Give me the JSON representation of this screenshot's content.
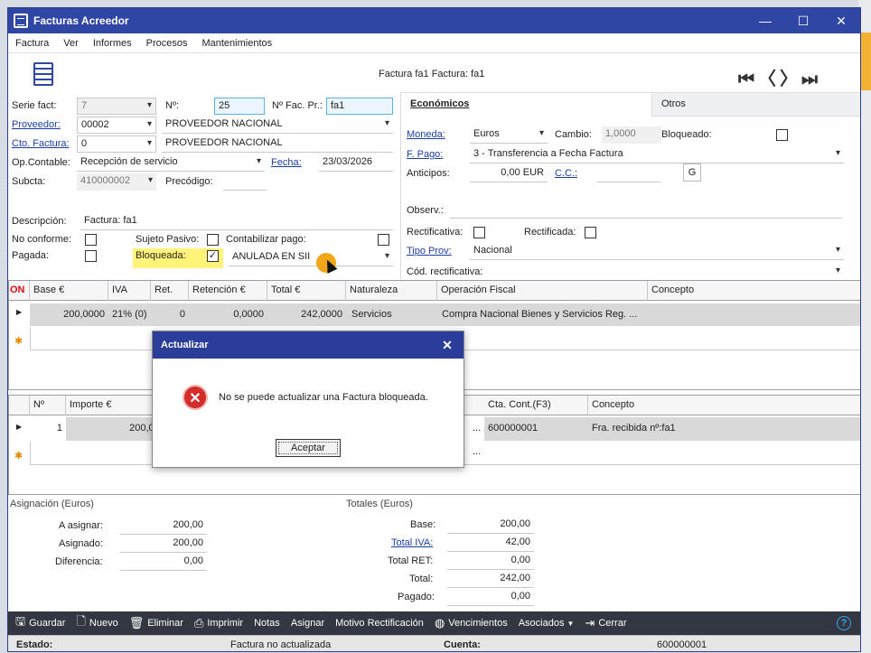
{
  "window": {
    "title": "Facturas Acreedor"
  },
  "menu": [
    "Factura",
    "Ver",
    "Informes",
    "Procesos",
    "Mantenimientos"
  ],
  "header": {
    "title": "Factura fa1  Factura: fa1"
  },
  "nav": {
    "first": "⏮",
    "prev": "〈",
    "next": "〉",
    "last": "⏭"
  },
  "form": {
    "serie_label": "Serie fact:",
    "serie_value": "7",
    "num_label": "Nº:",
    "num_value": "25",
    "nfacpr_label": "Nº Fac. Pr.:",
    "nfacpr_value": "fa1",
    "proveedor_label": "Proveedor:",
    "proveedor_code": "00002",
    "proveedor_name": "PROVEEDOR NACIONAL",
    "cto_label": "Cto. Factura:",
    "cto_value": "0",
    "cto_name": "PROVEEDOR NACIONAL",
    "opcont_label": "Op.Contable:",
    "opcont_value": "Recepción de servicio",
    "fecha_label": "Fecha:",
    "fecha_value": "23/03/2026",
    "subcta_label": "Subcta:",
    "subcta_value": "410000002",
    "precodigo_label": "Precódigo:",
    "descripcion_label": "Descripción:",
    "descripcion_value": "Factura: fa1",
    "noconforme_label": "No conforme:",
    "sujetopasivo_label": "Sujeto Pasivo:",
    "contabilizar_label": "Contabilizar pago:",
    "pagada_label": "Pagada:",
    "bloqueada_label": "Bloqueada:",
    "estado_sii": "ANULADA EN SII"
  },
  "tabs": {
    "economicos": "Económicos",
    "otros": "Otros"
  },
  "economicos": {
    "moneda_label": "Moneda:",
    "moneda_value": "Euros",
    "cambio_label": "Cambio:",
    "cambio_value": "1,0000",
    "bloqueado_label": "Bloqueado:",
    "fpago_label": "F. Pago:",
    "fpago_value": "3 - Transferencia a Fecha Factura",
    "anticipos_label": "Anticipos:",
    "anticipos_value": "0,00 EUR",
    "cc_label": "C.C.:",
    "g_button": "G",
    "observ_label": "Observ.:",
    "rectificativa_label": "Rectificativa:",
    "rectificada_label": "Rectificada:",
    "tipoprov_label": "Tipo Prov:",
    "tipoprov_value": "Nacional",
    "codrect_label": "Cód. rectificativa:"
  },
  "grid1": {
    "marker": "ON",
    "columns": [
      "Base €",
      "IVA",
      "Ret.",
      "Retención €",
      "Total €",
      "Naturaleza",
      "Operación Fiscal",
      "Concepto"
    ],
    "row": [
      "200,0000",
      "21% (0)",
      "0",
      "0,0000",
      "242,0000",
      "Servicios",
      "Compra Nacional Bienes y Servicios Reg. ...",
      ""
    ]
  },
  "grid2": {
    "columns": [
      "Nº",
      "Importe €",
      "Cta. Cont.(F3)",
      "Concepto"
    ],
    "row": [
      "1",
      "200,0000",
      "600000001",
      "Fra. recibida nº:fa1"
    ],
    "ellipsis": "..."
  },
  "dialog": {
    "title": "Actualizar",
    "message": "No se puede actualizar una Factura bloqueada.",
    "ok": "Aceptar",
    "close": "✕"
  },
  "asignacion": {
    "title": "Asignación (Euros)",
    "asignar_label": "A asignar:",
    "asignar_value": "200,00",
    "asignado_label": "Asignado:",
    "asignado_value": "200,00",
    "diferencia_label": "Diferencia:",
    "diferencia_value": "0,00"
  },
  "totales": {
    "title": "Totales (Euros)",
    "base_label": "Base:",
    "base_value": "200,00",
    "iva_label": "Total IVA:",
    "iva_value": "42,00",
    "ret_label": "Total RET:",
    "ret_value": "0,00",
    "total_label": "Total:",
    "total_value": "242,00",
    "pagado_label": "Pagado:",
    "pagado_value": "0,00"
  },
  "toolbar": {
    "guardar": "Guardar",
    "nuevo": "Nuevo",
    "eliminar": "Eliminar",
    "imprimir": "Imprimir",
    "notas": "Notas",
    "asignar": "Asignar",
    "motivo": "Motivo Rectificación",
    "vencimientos": "Vencimientos",
    "asociados": "Asociados",
    "cerrar": "Cerrar",
    "help": "?"
  },
  "status": {
    "estado_label": "Estado:",
    "estado_value": "Factura no actualizada",
    "cuenta_label": "Cuenta:",
    "cuenta_value": "600000001"
  },
  "colors": {
    "titlebar": "#2f46a5",
    "dialog_title": "#2a3e99",
    "highlight": "#fff37a",
    "cursor": "#f2a516"
  }
}
